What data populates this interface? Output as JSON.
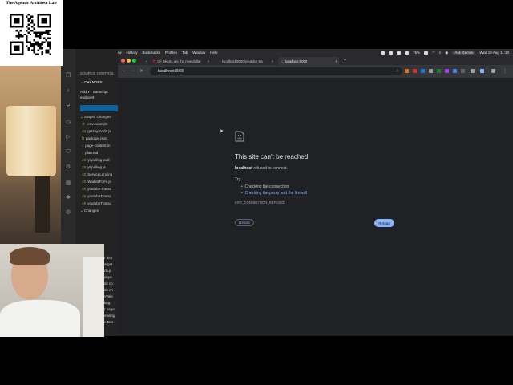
{
  "overlay": {
    "lab_title": "The Agentic Architect Lab"
  },
  "menubar": {
    "app": "Chrome",
    "items": [
      "File",
      "Edit",
      "View",
      "History",
      "Bookmarks",
      "Profiles",
      "Tab",
      "Window",
      "Help"
    ],
    "battery": "76%",
    "ask_gemini": "Ask Gemini",
    "datetime": "Wed 19 Aug 11:10"
  },
  "vscode": {
    "section_title": "SOURCE CONTROL",
    "changes_header": "CHANGES",
    "commit_message": "Add YT transcript endpoint",
    "staged_changes": "Staged Changes",
    "files": [
      ".env.example",
      "gatsby-node.js",
      "package.json",
      "page-content.m",
      "plan.md",
      "yt-pulling-wall",
      "yt-pulling.js",
      "ServiceLanding",
      "WaitlistForm.js",
      "youtube-transc",
      "youtubeTransc",
      "youtubeTransc"
    ],
    "changes": "Changes",
    "lower_items": [
      "r dep",
      "arget",
      "ch.js",
      "deps",
      "ds co",
      "ds ch",
      "vVale",
      "ting.",
      "r page",
      "ending",
      "e Dat"
    ]
  },
  "chrome": {
    "tabs": [
      {
        "label": "(1) tokens are the new dollar"
      },
      {
        "label": "localhost:8000/youtube-tra"
      },
      {
        "label": "localhost:8000"
      }
    ],
    "url": "localhost:8000"
  },
  "error_page": {
    "title": "This site can’t be reached",
    "host": "localhost",
    "desc_rest": " refused to connect.",
    "try": "Try:",
    "suggestions": [
      "Checking the connection",
      "Checking the proxy and the firewall"
    ],
    "code": "ERR_CONNECTION_REFUSED",
    "details_button": "Details",
    "reload_button": "Reload"
  },
  "colors": {
    "page_bg": "#202124",
    "link": "#8ab4f8",
    "vscode_bg": "#1e1e1e",
    "commit_button": "#0e639c"
  }
}
